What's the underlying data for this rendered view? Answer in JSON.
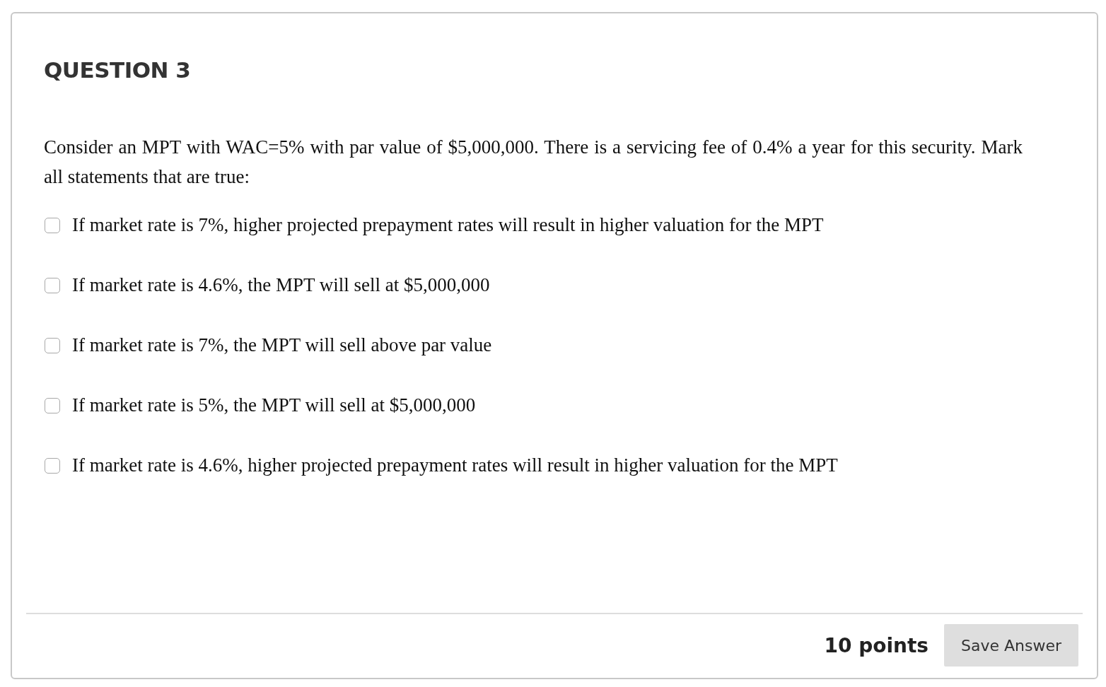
{
  "question": {
    "title": "QUESTION 3",
    "prompt": "Consider an MPT with WAC=5% with par value of $5,000,000. There is a servicing fee of 0.4% a year for this security. Mark all statements that are true:",
    "options": [
      {
        "label": "If market rate is 7%, higher projected prepayment rates will result in higher valuation for the MPT",
        "checked": false
      },
      {
        "label": "If market rate is 4.6%, the MPT will sell at $5,000,000",
        "checked": false
      },
      {
        "label": "If market rate is 7%, the MPT will sell above par value",
        "checked": false
      },
      {
        "label": "If market rate is 5%, the MPT will sell at $5,000,000",
        "checked": false
      },
      {
        "label": "If market rate is 4.6%, higher projected prepayment rates will result in higher valuation for the MPT",
        "checked": false
      }
    ]
  },
  "footer": {
    "points": "10 points",
    "button": "Save Answer"
  }
}
